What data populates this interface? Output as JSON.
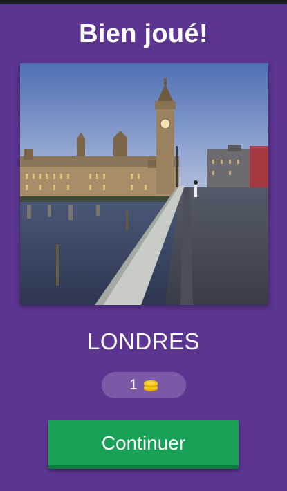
{
  "header": {
    "title": "Bien joué!"
  },
  "photo": {
    "subject": "london-big-ben-westminster-bridge"
  },
  "result": {
    "answer": "LONDRES"
  },
  "reward": {
    "coins": "1",
    "icon": "coin-stack-icon"
  },
  "actions": {
    "continue_label": "Continuer"
  },
  "colors": {
    "background": "#5b3590",
    "pill": "#7b5ba8",
    "button": "#18a157",
    "coin": "#f5c518"
  }
}
